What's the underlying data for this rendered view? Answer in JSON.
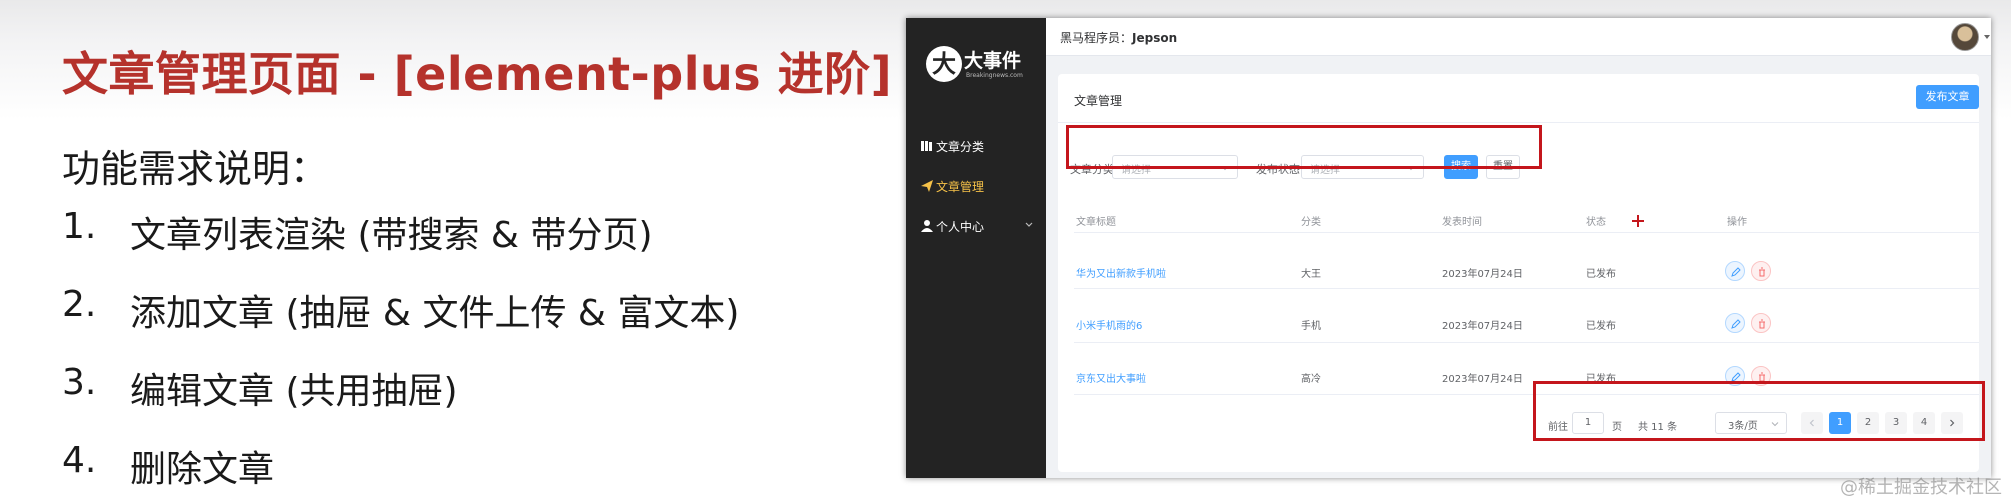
{
  "slide": {
    "title": "文章管理页面 - [element-plus 进阶]",
    "subtitle": "功能需求说明：",
    "requirements": [
      {
        "num": "1.",
        "text": "文章列表渲染 (带搜索 & 带分页)"
      },
      {
        "num": "2.",
        "text": "添加文章 (抽屉 & 文件上传 & 富文本)"
      },
      {
        "num": "3.",
        "text": "编辑文章 (共用抽屉)"
      },
      {
        "num": "4.",
        "text": "删除文章"
      }
    ]
  },
  "app": {
    "logo": {
      "mark": "大",
      "text": "大事件",
      "sub": "Breakingnews.com"
    },
    "menu": [
      {
        "label": "文章分类",
        "icon": "folder-icon",
        "active": false
      },
      {
        "label": "文章管理",
        "icon": "paper-plane-icon",
        "active": true
      },
      {
        "label": "个人中心",
        "icon": "user-icon",
        "active": false
      }
    ],
    "topbar": {
      "user_prefix": "黑马程序员：",
      "user_name": "Jepson"
    },
    "card": {
      "title": "文章管理",
      "publish_button": "发布文章",
      "filters": {
        "category_label": "文章分类:",
        "category_placeholder": "请选择",
        "status_label": "发布状态:",
        "status_placeholder": "请选择",
        "search_button": "搜索",
        "reset_button": "重置"
      },
      "table": {
        "headers": [
          "文章标题",
          "分类",
          "发表时间",
          "状态",
          "操作"
        ],
        "rows": [
          {
            "title": "华为又出新款手机啦",
            "category": "大王",
            "date": "2023年07月24日",
            "status": "已发布"
          },
          {
            "title": "小米手机雨的6",
            "category": "手机",
            "date": "2023年07月24日",
            "status": "已发布"
          },
          {
            "title": "京东又出大事啦",
            "category": "高冷",
            "date": "2023年07月24日",
            "status": "已发布"
          }
        ]
      },
      "pagination": {
        "goto_label": "前往",
        "goto_value": "1",
        "page_label": "页",
        "total_label": "共 11 条",
        "page_size": "3条/页",
        "pages": [
          "1",
          "2",
          "3",
          "4"
        ],
        "current_page": "1"
      }
    },
    "colors": {
      "primary": "#409eff",
      "sidebar": "#232323",
      "active_menu": "#f5c148",
      "highlight_box": "#c4161c"
    }
  },
  "watermark": "@稀土掘金技术社区"
}
